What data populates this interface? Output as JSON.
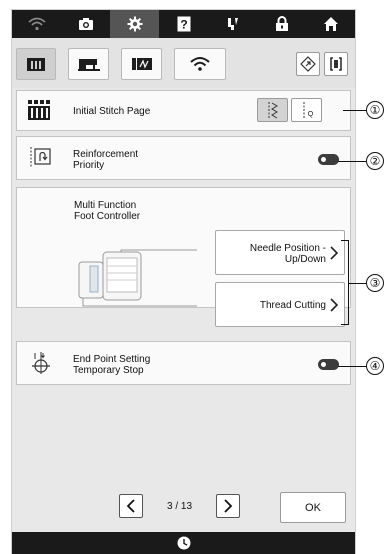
{
  "topbar": {
    "tabs": [
      {
        "icon": "wifi-icon",
        "state": "dim"
      },
      {
        "icon": "camera-icon",
        "state": "normal"
      },
      {
        "icon": "gear-icon",
        "state": "active"
      },
      {
        "icon": "help-icon",
        "state": "normal",
        "glyph": "?"
      },
      {
        "icon": "needle-icon",
        "state": "normal"
      },
      {
        "icon": "lock-icon",
        "state": "normal"
      },
      {
        "icon": "home-icon",
        "state": "normal"
      }
    ]
  },
  "subbar": {
    "tabs": [
      {
        "icon": "machine-settings-icon",
        "active": true
      },
      {
        "icon": "sewing-machine-icon",
        "active": false
      },
      {
        "icon": "embroidery-frame-icon",
        "active": false
      },
      {
        "icon": "wireless-icon",
        "active": false
      }
    ],
    "right_buttons": [
      {
        "icon": "diamond-icon"
      },
      {
        "icon": "bracket-icon"
      }
    ]
  },
  "rows": {
    "initial_stitch": {
      "label": "Initial Stitch Page",
      "options": [
        "zigzag",
        "straight-q"
      ],
      "option2_text": "Q",
      "selected": 0
    },
    "reinforcement": {
      "label_line1": "Reinforcement",
      "label_line2": "Priority",
      "toggle": "off"
    },
    "multi_function": {
      "title_line1": "Multi Function",
      "title_line2": "Foot Controller",
      "button1_line1": "Needle Position -",
      "button1_line2": "Up/Down",
      "button2": "Thread Cutting"
    },
    "end_point": {
      "label_line1": "End Point Setting",
      "label_line2": "Temporary Stop",
      "toggle": "off"
    }
  },
  "nav": {
    "page": "3 / 13",
    "ok": "OK"
  },
  "callouts": [
    "①",
    "②",
    "③",
    "④"
  ],
  "colors": {
    "topbar": "#1a1a1a",
    "active_tab": "#555555",
    "background": "#e8e8e8",
    "row": "#fafafa"
  }
}
